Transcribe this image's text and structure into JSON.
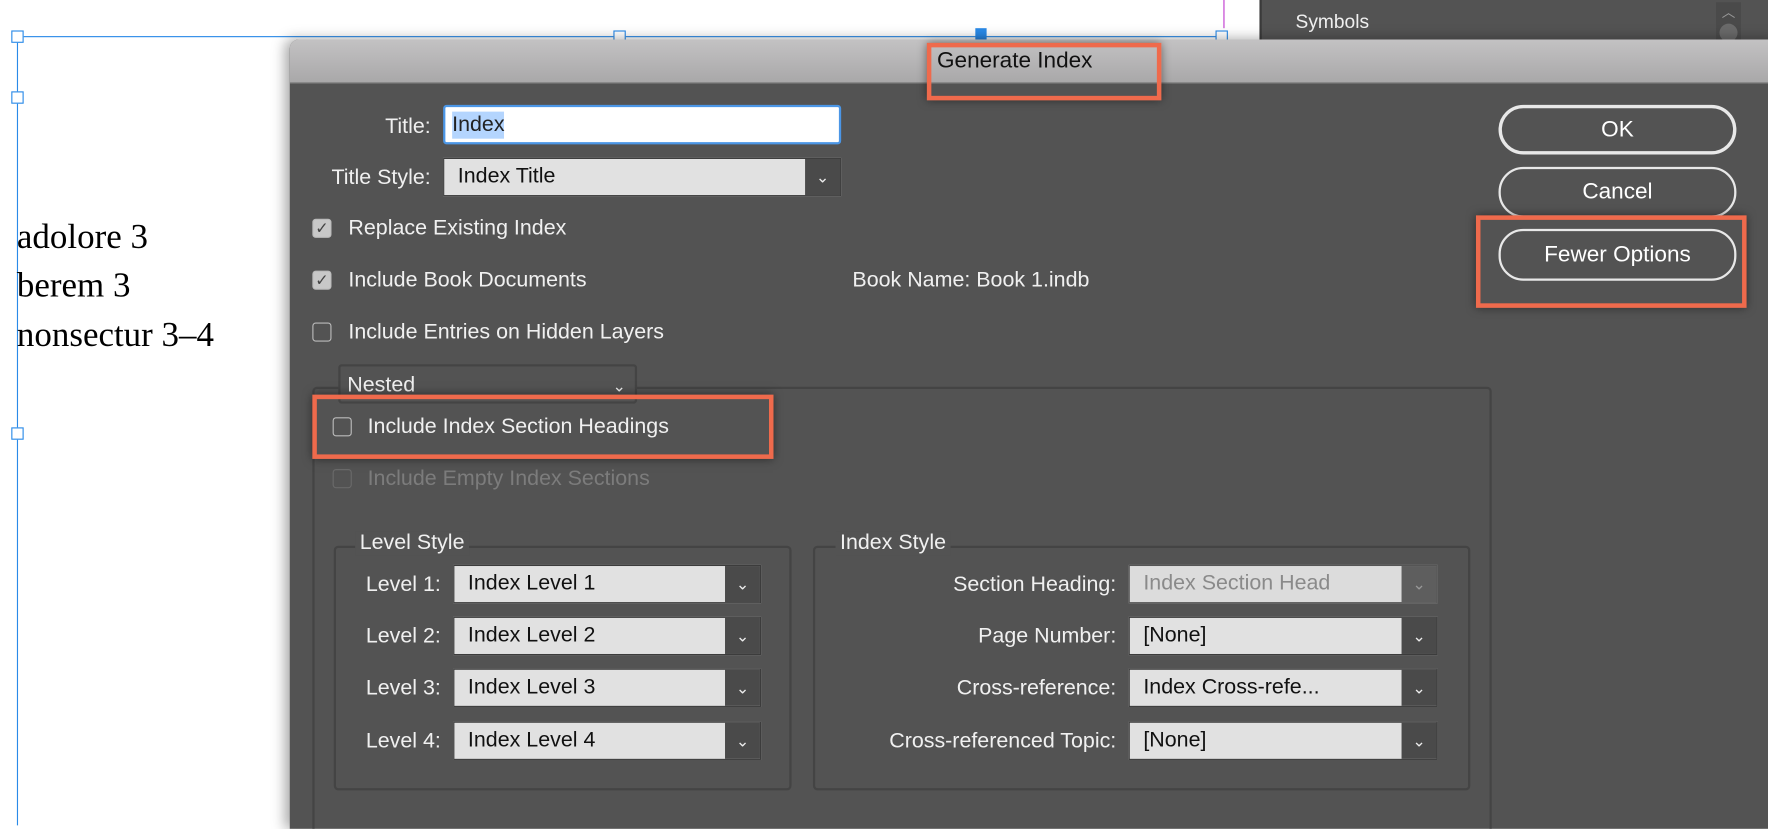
{
  "document": {
    "lines": [
      "adolore  3",
      "berem  3",
      "nonsectur  3–4"
    ]
  },
  "panel": {
    "item": "Symbols"
  },
  "dialog": {
    "title": "Generate Index",
    "title_label": "Title:",
    "title_value": "Index",
    "title_style_label": "Title Style:",
    "title_style_value": "Index Title",
    "replace_existing": {
      "label": "Replace Existing Index",
      "checked": true
    },
    "include_book": {
      "label": "Include Book Documents",
      "checked": true
    },
    "book_name": "Book Name:  Book 1.indb",
    "hidden_layers": {
      "label": "Include Entries on Hidden Layers",
      "checked": false
    },
    "format_value": "Nested",
    "section_headings": {
      "label": "Include Index Section Headings",
      "checked": false
    },
    "empty_sections": {
      "label": "Include Empty Index Sections",
      "checked": false,
      "disabled": true
    },
    "buttons": {
      "ok": "OK",
      "cancel": "Cancel",
      "fewer": "Fewer Options"
    },
    "level_style": {
      "title": "Level Style",
      "rows": [
        {
          "label": "Level 1:",
          "value": "Index Level 1"
        },
        {
          "label": "Level 2:",
          "value": "Index Level 2"
        },
        {
          "label": "Level 3:",
          "value": "Index Level 3"
        },
        {
          "label": "Level 4:",
          "value": "Index Level 4"
        }
      ]
    },
    "index_style": {
      "title": "Index Style",
      "rows": [
        {
          "label": "Section Heading:",
          "value": "Index Section Head"
        },
        {
          "label": "Page Number:",
          "value": "[None]"
        },
        {
          "label": "Cross-reference:",
          "value": "Index Cross-refe..."
        },
        {
          "label": "Cross-referenced Topic:",
          "value": "[None]"
        }
      ]
    }
  },
  "colors": {
    "highlight": "#ef6a4c",
    "dialog_bg": "#535353",
    "selection": "#2a8ae8"
  }
}
